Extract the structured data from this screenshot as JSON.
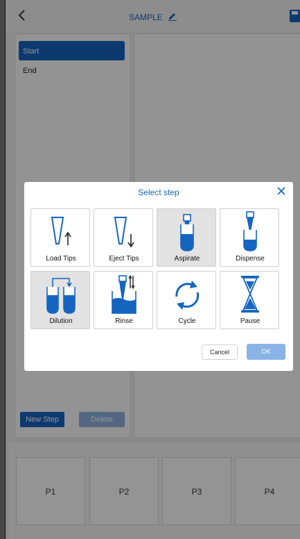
{
  "header": {
    "title": "SAMPLE"
  },
  "steps": [
    {
      "label": "Start",
      "active": true
    },
    {
      "label": "End",
      "active": false
    }
  ],
  "actions": {
    "new_step": "New Step",
    "delete": "Delete"
  },
  "plates": [
    "P1",
    "P2",
    "P3",
    "P4"
  ],
  "dialog": {
    "title": "Select step",
    "tiles": [
      {
        "label": "Load Tips",
        "icon": "load-tips-icon",
        "selected": false
      },
      {
        "label": "Eject Tips",
        "icon": "eject-tips-icon",
        "selected": false
      },
      {
        "label": "Aspirate",
        "icon": "aspirate-icon",
        "selected": true
      },
      {
        "label": "Dispense",
        "icon": "dispense-icon",
        "selected": false
      },
      {
        "label": "Dilution",
        "icon": "dilution-icon",
        "selected": true
      },
      {
        "label": "Rinse",
        "icon": "rinse-icon",
        "selected": false
      },
      {
        "label": "Cycle",
        "icon": "cycle-icon",
        "selected": false
      },
      {
        "label": "Pause",
        "icon": "pause-icon",
        "selected": false
      }
    ],
    "cancel": "Cancel",
    "ok": "OK"
  },
  "colors": {
    "accent": "#1565c0",
    "accent_disabled": "#8ab4e6",
    "overlay": "rgba(0,0,0,0.42)"
  }
}
